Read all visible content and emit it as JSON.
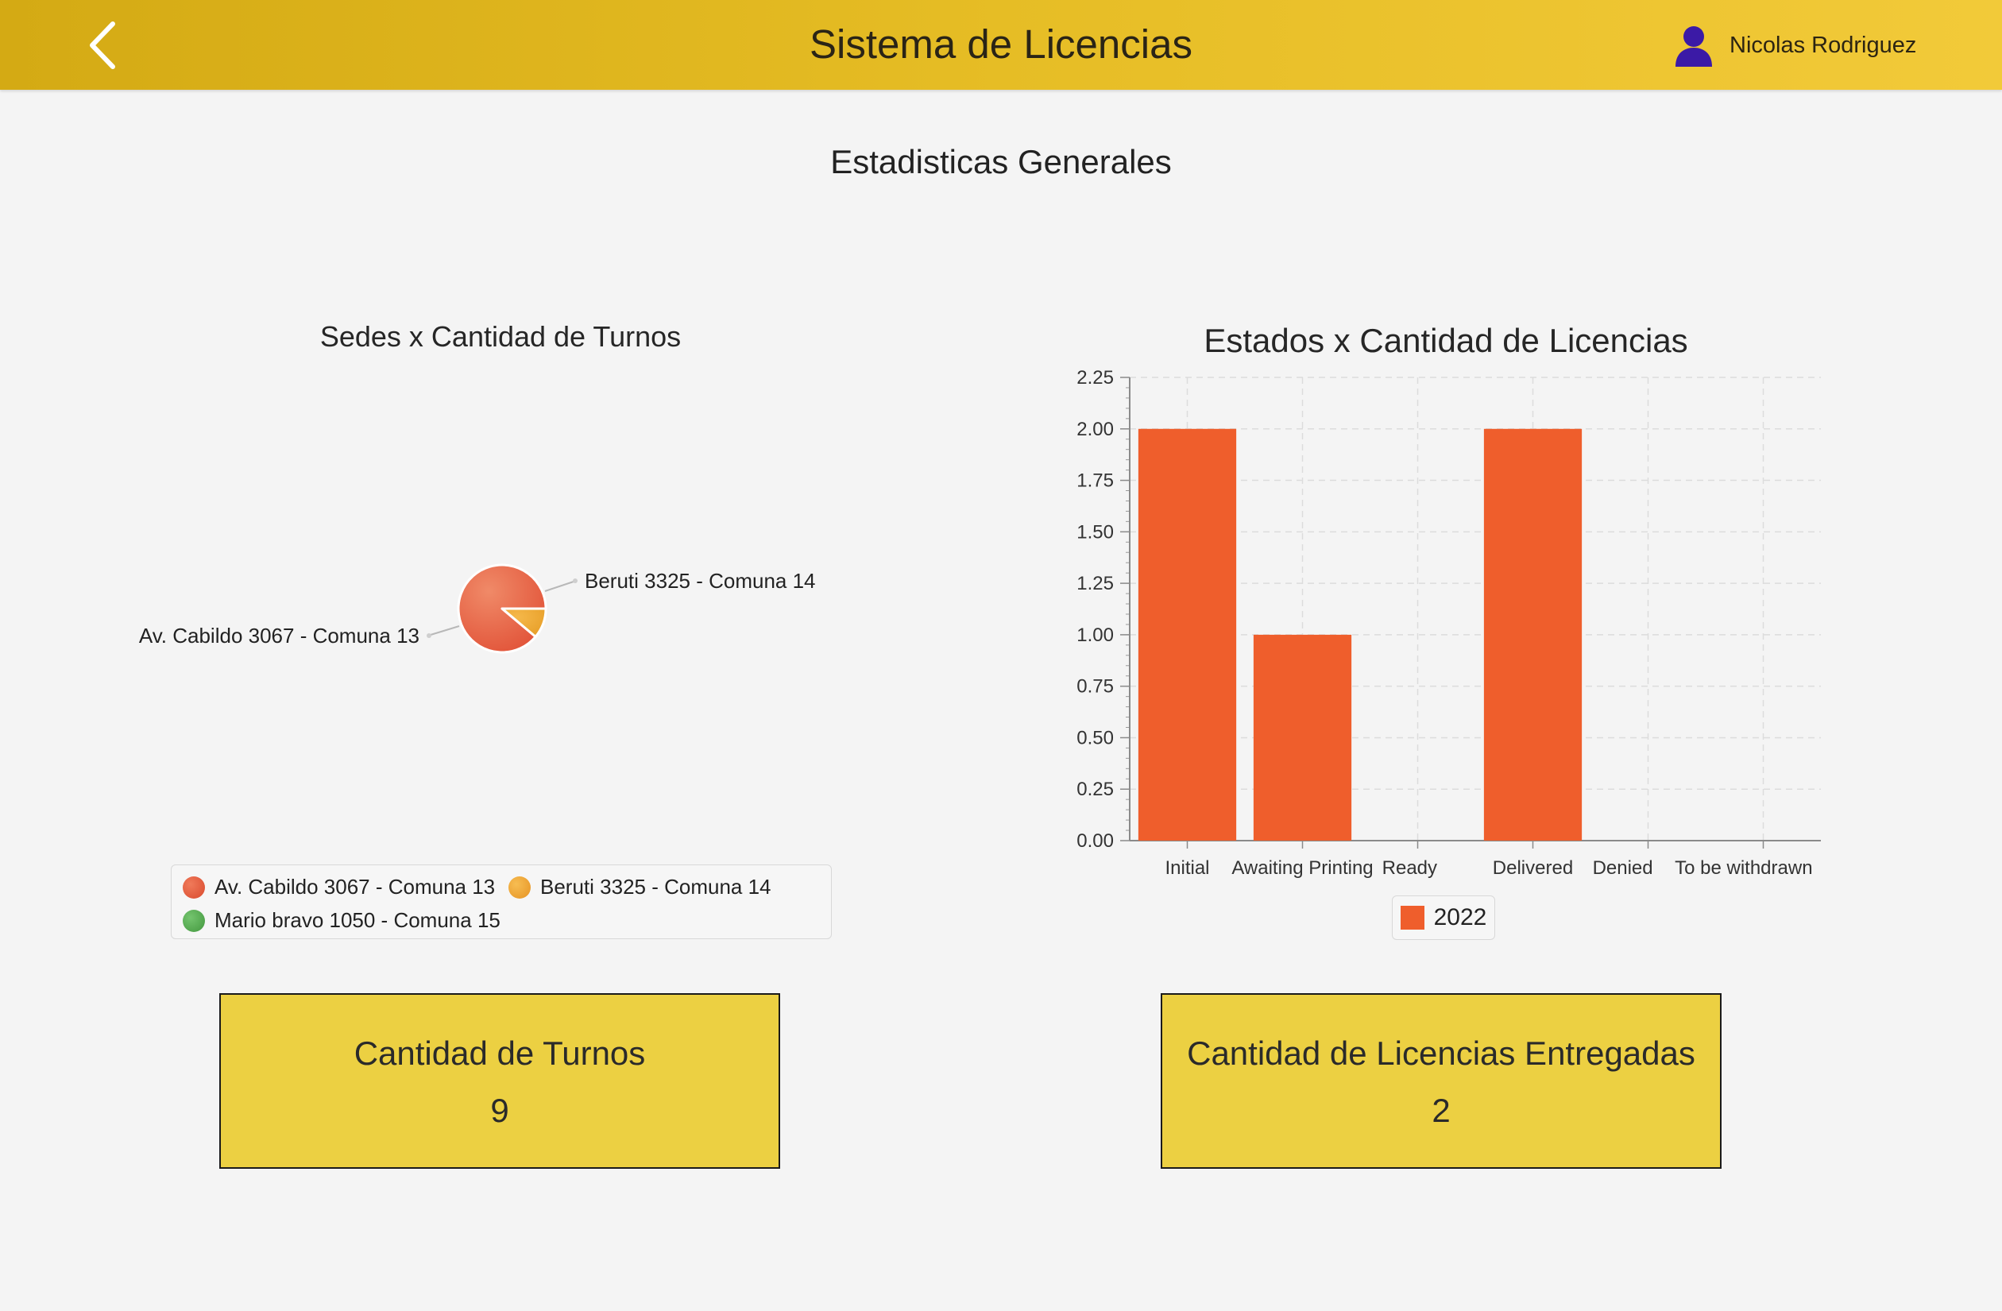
{
  "header": {
    "title": "Sistema de Licencias",
    "user_name": "Nicolas Rodriguez",
    "accent_color": "#e6bd25"
  },
  "page": {
    "title": "Estadisticas Generales"
  },
  "pie": {
    "title": "Sedes x Cantidad de Turnos",
    "legend": [
      {
        "label": "Av. Cabildo 3067 - Comuna 13",
        "color": "#e2553a"
      },
      {
        "label": "Beruti 3325 - Comuna 14",
        "color": "#f0a431"
      },
      {
        "label": "Mario bravo 1050 - Comuna 15",
        "color": "#52a74f"
      }
    ]
  },
  "bar": {
    "title": "Estados x Cantidad de Licencias",
    "legend_label": "2022",
    "color": "#ef5e2c"
  },
  "stats": {
    "turnos": {
      "label": "Cantidad de Turnos",
      "value": "9"
    },
    "licencias": {
      "label": "Cantidad de Licencias Entregadas",
      "value": "2"
    }
  },
  "chart_data": [
    {
      "type": "pie",
      "title": "Sedes x Cantidad de Turnos",
      "categories": [
        "Av. Cabildo 3067 - Comuna 13",
        "Beruti 3325 - Comuna 14",
        "Mario bravo 1050 - Comuna 15"
      ],
      "values": [
        8,
        1,
        0
      ],
      "colors": [
        "#e2553a",
        "#e8a02a",
        "#52a74f"
      ],
      "legend": "bottom"
    },
    {
      "type": "bar",
      "title": "Estados x Cantidad de Licencias",
      "categories": [
        "Initial",
        "Awaiting Printing",
        "Ready",
        "Delivered",
        "Denied",
        "To be withdrawn"
      ],
      "series": [
        {
          "name": "2022",
          "values": [
            2,
            1,
            0,
            2,
            0,
            0
          ]
        }
      ],
      "ylim": [
        0,
        2.25
      ],
      "yticks": [
        "0.00",
        "0.25",
        "0.50",
        "0.75",
        "1.00",
        "1.25",
        "1.50",
        "1.75",
        "2.00",
        "2.25"
      ],
      "grid": true,
      "legend": "bottom"
    }
  ]
}
